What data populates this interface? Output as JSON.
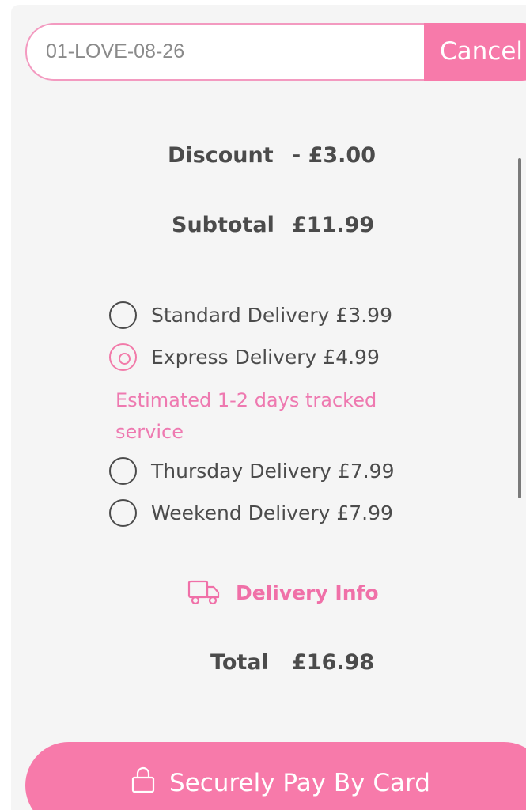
{
  "promo": {
    "code_value": "01-LOVE-08-26",
    "cancel_label": "Cancel"
  },
  "summary": {
    "discount_label": "Discount",
    "discount_value": "- £3.00",
    "subtotal_label": "Subtotal",
    "subtotal_value": "£11.99",
    "total_label": "Total",
    "total_value": "£16.98"
  },
  "delivery": {
    "options": [
      {
        "label": "Standard Delivery £3.99",
        "selected": false
      },
      {
        "label": "Express Delivery £4.99",
        "selected": true
      },
      {
        "label": "Thursday Delivery £7.99",
        "selected": false
      },
      {
        "label": "Weekend Delivery £7.99",
        "selected": false
      }
    ],
    "selected_note": "Estimated 1-2 days tracked service",
    "info_label": "Delivery Info",
    "info_icon": "truck-icon"
  },
  "pay": {
    "label": "Securely Pay By Card",
    "icon": "lock-icon"
  },
  "colors": {
    "accent": "#f77aaa",
    "accent_text": "#f070a8",
    "text": "#4b4b4b",
    "card_bg": "#f5f5f5"
  }
}
